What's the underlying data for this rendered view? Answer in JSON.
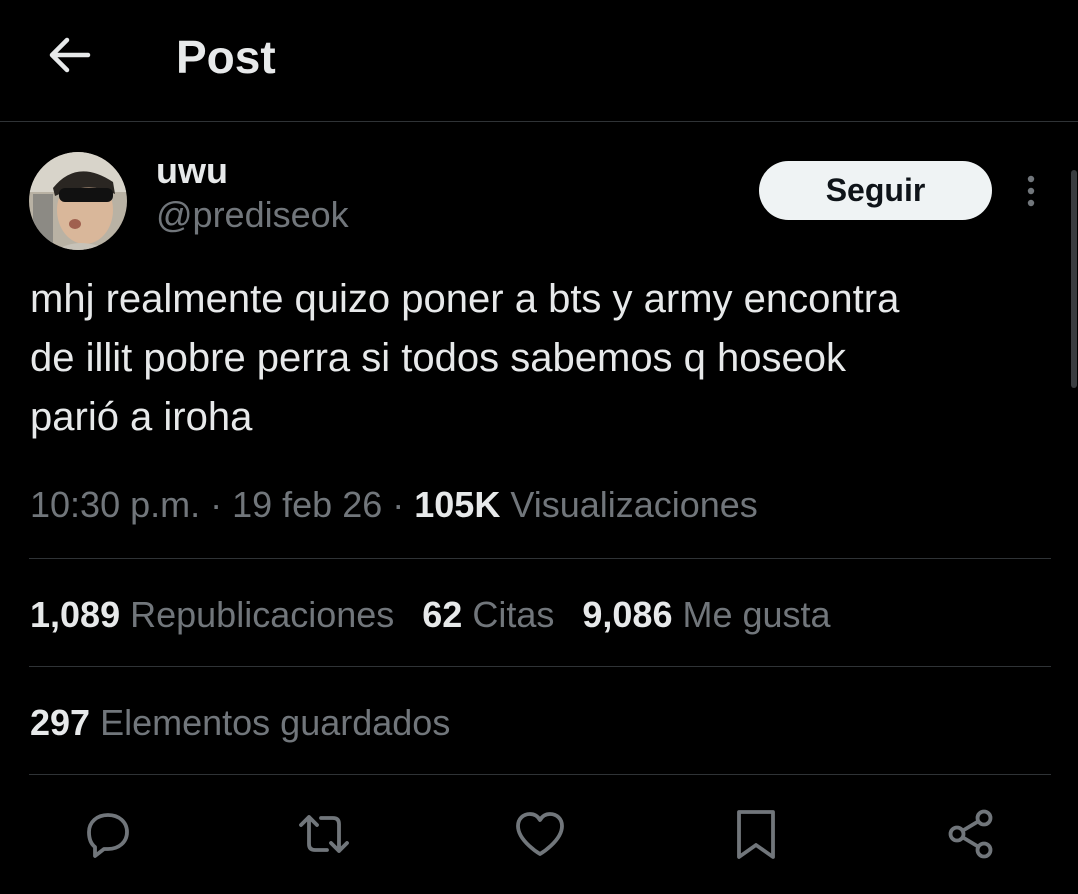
{
  "header": {
    "title": "Post",
    "back_icon": "arrow-left-icon"
  },
  "author": {
    "display_name": "uwu",
    "handle": "@prediseok",
    "avatar_icon": "avatar-photo"
  },
  "follow_button": {
    "label": "Seguir"
  },
  "more_icon": "more-vertical-icon",
  "tweet": {
    "text": "mhj realmente quizo poner a bts y army encontra\nde illit pobre perra si todos sabemos q hoseok\nparió a iroha",
    "time": "10:30 p.m.",
    "sep1": " · ",
    "date": "19 feb 26",
    "sep2": " · ",
    "views_count": "105K",
    "views_label": "Visualizaciones"
  },
  "stats": {
    "reposts_count": "1,089",
    "reposts_label": "Republicaciones",
    "quotes_count": "62",
    "quotes_label": "Citas",
    "likes_count": "9,086",
    "likes_label": "Me gusta",
    "bookmarks_count": "297",
    "bookmarks_label": "Elementos guardados"
  },
  "actions": [
    {
      "icon": "reply-icon"
    },
    {
      "icon": "repost-icon"
    },
    {
      "icon": "like-icon"
    },
    {
      "icon": "bookmark-icon"
    },
    {
      "icon": "share-icon"
    }
  ],
  "colors": {
    "background": "#000000",
    "text_primary": "#e7e9ea",
    "text_secondary": "#71767b",
    "divider": "#2f3336",
    "follow_button_bg": "#eff3f4"
  }
}
